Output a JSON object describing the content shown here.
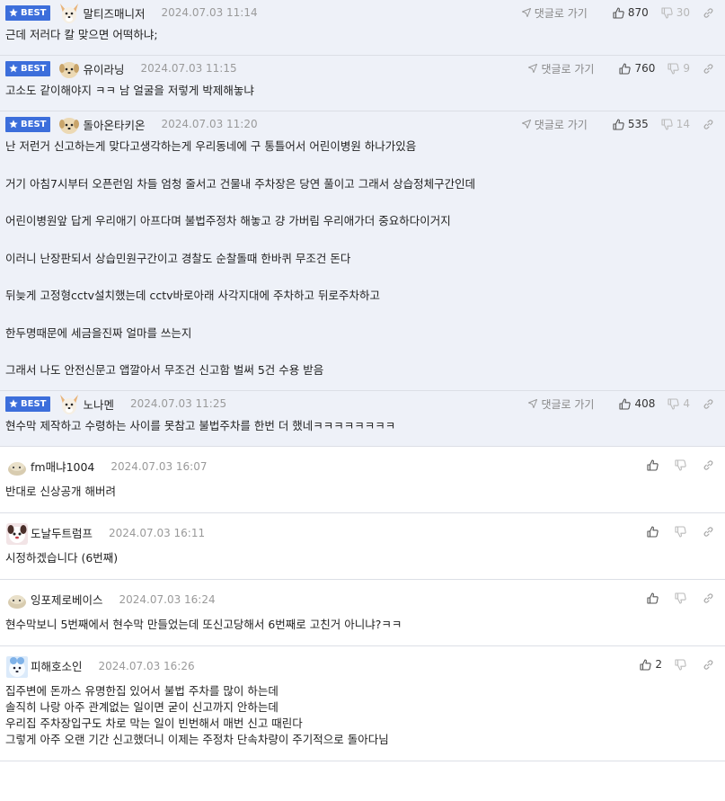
{
  "reply_label": "댓글로 가기",
  "colors": {
    "best_bg": "#eef1f8",
    "badge": "#3c6edb"
  },
  "comments": [
    {
      "best": true,
      "badge": "BEST",
      "avatar": "dog-avatar",
      "nick": "말티즈매니저",
      "date": "2024.07.03 11:14",
      "up": "870",
      "down": "30",
      "lines": [
        "근데 저러다 칼 맞으면 어떡하냐;"
      ]
    },
    {
      "best": true,
      "badge": "BEST",
      "avatar": "puppy-avatar",
      "nick": "유이라닝",
      "date": "2024.07.03 11:15",
      "up": "760",
      "down": "9",
      "lines": [
        "고소도 같이해야지 ㅋㅋ 남 얼굴을 저렇게 박제해놓냐"
      ]
    },
    {
      "best": true,
      "badge": "BEST",
      "avatar": "puppy-avatar",
      "nick": "돌아온타키온",
      "date": "2024.07.03 11:20",
      "up": "535",
      "down": "14",
      "lines": [
        "난 저런거 신고하는게 맞다고생각하는게 우리동네에 구 통틀어서 어린이병원 하나가있음",
        "거기 아침7시부터 오픈런임 차들 엄청 줄서고 건물내 주차장은 당연 풀이고 그래서 상습정체구간인데",
        "어린이병원앞 답게 우리애기 아프다며 불법주정차 해놓고 걍 가버림 우리애가더 중요하다이거지",
        "이러니 난장판되서 상습민원구간이고 경찰도 순찰돌때 한바퀴 무조건 돈다",
        "뒤늦게 고정형cctv설치했는데 cctv바로아래 사각지대에 주차하고 뒤로주차하고",
        "한두명때문에 세금을진짜 얼마를 쓰는지",
        "그래서 나도 안전신문고 앱깔아서 무조건 신고함 벌써 5건 수용 받음"
      ]
    },
    {
      "best": true,
      "badge": "BEST",
      "avatar": "dog-avatar",
      "nick": "노나멘",
      "date": "2024.07.03 11:25",
      "up": "408",
      "down": "4",
      "lines": [
        "현수막 제작하고 수령하는 사이를 못참고 불법주차를 한번 더 했네ㅋㅋㅋㅋㅋㅋㅋㅋ"
      ]
    },
    {
      "best": false,
      "avatar": "blob-avatar",
      "nick": "fm매냐1004",
      "date": "2024.07.03 16:07",
      "up": "",
      "down": "",
      "lines": [
        "반대로 신상공개 해버려"
      ]
    },
    {
      "best": false,
      "avatar": "dog-face-avatar",
      "nick": "도날두트럼프",
      "date": "2024.07.03 16:11",
      "up": "",
      "down": "",
      "lines": [
        "시정하겠습니다 (6번째)"
      ]
    },
    {
      "best": false,
      "avatar": "blob-avatar",
      "nick": "잉포제로베이스",
      "date": "2024.07.03 16:24",
      "up": "",
      "down": "",
      "lines": [
        "현수막보니 5번째에서 현수막 만들었는데 또신고당해서 6번째로 고친거 아니냐?ㅋㅋ"
      ]
    },
    {
      "best": false,
      "avatar": "blue-avatar",
      "nick": "피해호소인",
      "date": "2024.07.03 16:26",
      "up": "2",
      "down": "",
      "lines": [
        "집주변에 돈까스 유명한집 있어서 불법 주차를 많이 하는데",
        "솔직히 나랑 아주 관계없는 일이면 굳이 신고까지 안하는데",
        "우리집 주차장입구도 차로 막는 일이 빈번해서 매번 신고 때린다",
        "그렇게 아주 오랜 기간 신고했더니 이제는 주정차 단속차량이 주기적으로 돌아다님"
      ]
    }
  ]
}
